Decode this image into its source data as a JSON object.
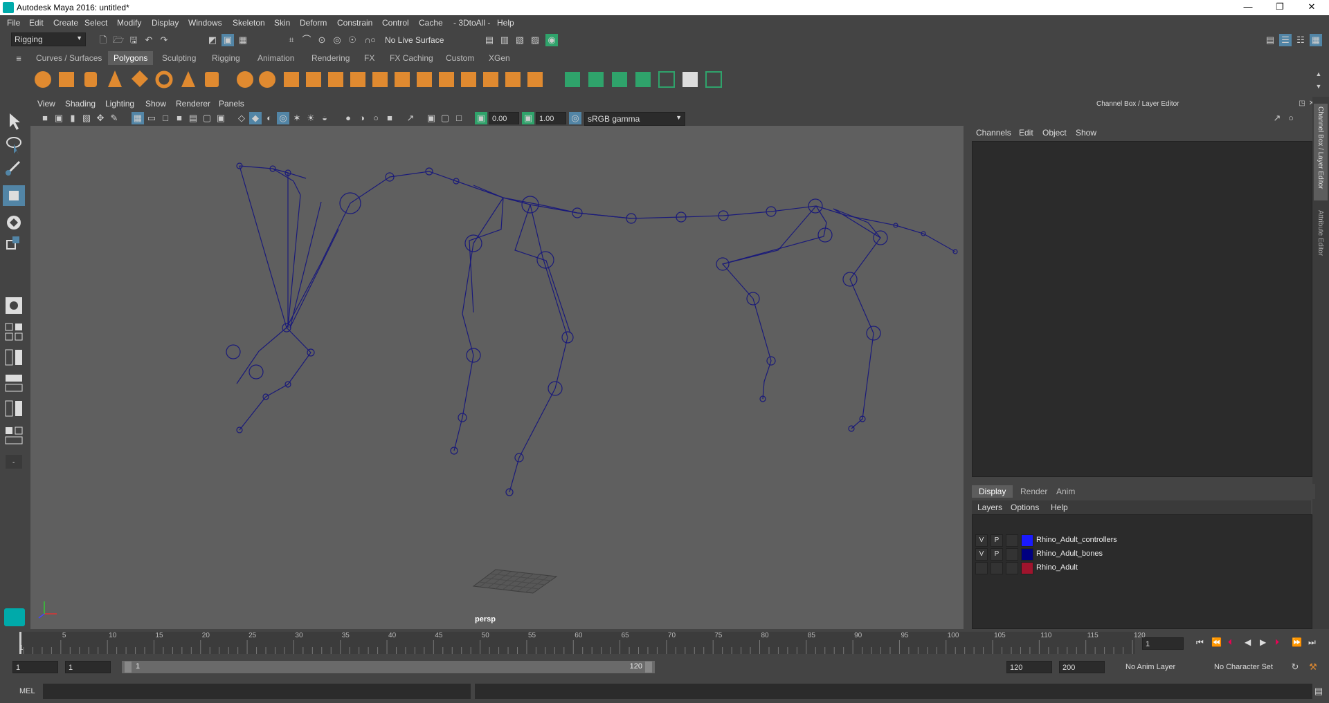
{
  "window": {
    "title": "Autodesk Maya 2016: untitled*"
  },
  "menubar": [
    "File",
    "Edit",
    "Create",
    "Select",
    "Modify",
    "Display",
    "Windows",
    "Skeleton",
    "Skin",
    "Deform",
    "Constrain",
    "Control",
    "Cache",
    "- 3DtoAll -",
    "Help"
  ],
  "statusline": {
    "menuset": "Rigging",
    "live_surface": "No Live Surface"
  },
  "shelf": {
    "tabs": [
      "Curves / Surfaces",
      "Polygons",
      "Sculpting",
      "Rigging",
      "Animation",
      "Rendering",
      "FX",
      "FX Caching",
      "Custom",
      "XGen"
    ],
    "active_tab": "Polygons"
  },
  "viewport": {
    "menus": [
      "View",
      "Shading",
      "Lighting",
      "Show",
      "Renderer",
      "Panels"
    ],
    "exposure": "0.00",
    "gamma": "1.00",
    "color_space": "sRGB gamma",
    "camera_label": "persp"
  },
  "channelbox": {
    "title": "Channel Box / Layer Editor",
    "menus": [
      "Channels",
      "Edit",
      "Object",
      "Show"
    ],
    "side_tabs": [
      "Channel Box / Layer Editor",
      "Attribute Editor"
    ]
  },
  "layers": {
    "tabs": [
      "Display",
      "Render",
      "Anim"
    ],
    "active_tab": "Display",
    "menus": [
      "Layers",
      "Options",
      "Help"
    ],
    "rows": [
      {
        "v": "V",
        "p": "P",
        "color": "#1a1aff",
        "name": "Rhino_Adult_controllers"
      },
      {
        "v": "V",
        "p": "P",
        "color": "#000080",
        "name": "Rhino_Adult_bones"
      },
      {
        "v": "",
        "p": "",
        "color": "#a0142d",
        "name": "Rhino_Adult"
      }
    ]
  },
  "timeline": {
    "ticks": [
      "5",
      "10",
      "15",
      "20",
      "25",
      "30",
      "35",
      "40",
      "45",
      "50",
      "55",
      "60",
      "65",
      "70",
      "75",
      "80",
      "85",
      "90",
      "95",
      "100",
      "105",
      "110",
      "115",
      "120"
    ],
    "start_label": "1",
    "current_frame": "1"
  },
  "range": {
    "start": "1",
    "playback_start": "1",
    "slider_start": "1",
    "slider_end": "120",
    "playback_end": "120",
    "end": "200",
    "anim_layer": "No Anim Layer",
    "character_set": "No Character Set"
  },
  "cmdline": {
    "lang": "MEL"
  },
  "colors": {
    "skeleton": "#1a1a7a",
    "accent": "#5285a6",
    "highlight": "#4aa3d8"
  }
}
